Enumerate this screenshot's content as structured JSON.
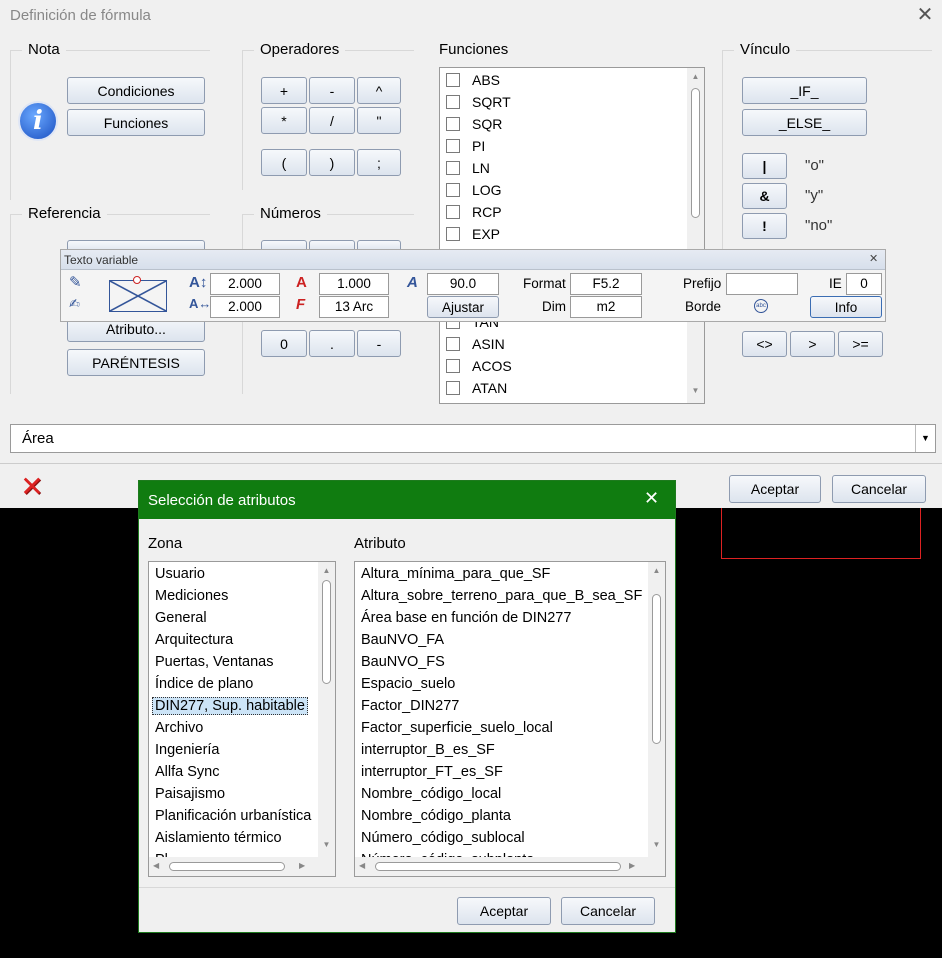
{
  "main": {
    "title": "Definición de fórmula",
    "groups": {
      "nota": "Nota",
      "operadores": "Operadores",
      "funciones": "Funciones",
      "vinculo": "Vínculo",
      "referencia": "Referencia",
      "numeros": "Números"
    },
    "nota_buttons": [
      "Condiciones",
      "Funciones"
    ],
    "operators_row1": [
      "+",
      "-",
      "^"
    ],
    "operators_row2": [
      "*",
      "/",
      "\""
    ],
    "operators_row3": [
      "(",
      ")",
      ";"
    ],
    "numeros_visible": [
      "0",
      ".",
      "-"
    ],
    "referencia_buttons": [
      "Atributo...",
      "PARÉNTESIS"
    ],
    "functions_top": [
      "ABS",
      "SQRT",
      "SQR",
      "PI",
      "LN",
      "LOG",
      "RCP",
      "EXP"
    ],
    "functions_bottom": [
      "TAN",
      "ASIN",
      "ACOS",
      "ATAN"
    ],
    "vinculo": {
      "if": "_IF_",
      "else": "_ELSE_",
      "or_sym": "|",
      "or_label": "\"o\"",
      "and_sym": "&",
      "and_label": "\"y\"",
      "not_sym": "!",
      "not_label": "\"no\"",
      "cmp": [
        "<>",
        ">",
        ">="
      ]
    },
    "area_value": "Área",
    "accept": "Aceptar",
    "cancel": "Cancelar"
  },
  "texto_variable": {
    "title": "Texto variable",
    "height": "2.000",
    "width": "2.000",
    "ratio": "1.000",
    "font": "13 Arc",
    "angle": "90.0",
    "adjust": "Ajustar",
    "format_label": "Format",
    "format_value": "F5.2",
    "dim_label": "Dim",
    "dim_value": "m2",
    "prefix_label": "Prefijo",
    "prefix_value": "",
    "ie_label": "IE",
    "ie_value": "0",
    "border_label": "Borde",
    "info": "Info"
  },
  "seleccion": {
    "title": "Selección de atributos",
    "zona_label": "Zona",
    "atributo_label": "Atributo",
    "zonas": [
      "Usuario",
      "Mediciones",
      "General",
      "Arquitectura",
      "Puertas, Ventanas",
      "Índice de plano",
      "DIN277, Sup. habitable",
      "Archivo",
      "Ingeniería",
      "Allfa Sync",
      "Paisajismo",
      "Planificación urbanística",
      "Aislamiento térmico",
      "Pl..."
    ],
    "selected_zona": "DIN277, Sup. habitable",
    "atributos": [
      "Altura_mínima_para_que_SF",
      "Altura_sobre_terreno_para_que_B_sea_SF",
      "Área base en función de DIN277",
      "BauNVO_FA",
      "BauNVO_FS",
      "Espacio_suelo",
      "Factor_DIN277",
      "Factor_superficie_suelo_local",
      "interruptor_B_es_SF",
      "interruptor_FT_es_SF",
      "Nombre_código_local",
      "Nombre_código_planta",
      "Número_código_sublocal",
      "Número_código_subplanta"
    ],
    "accept": "Aceptar",
    "cancel": "Cancelar"
  },
  "colors": {
    "accent_green": "#107c10",
    "button_border": "#8e9bb0",
    "selection": "#cce4f7"
  }
}
